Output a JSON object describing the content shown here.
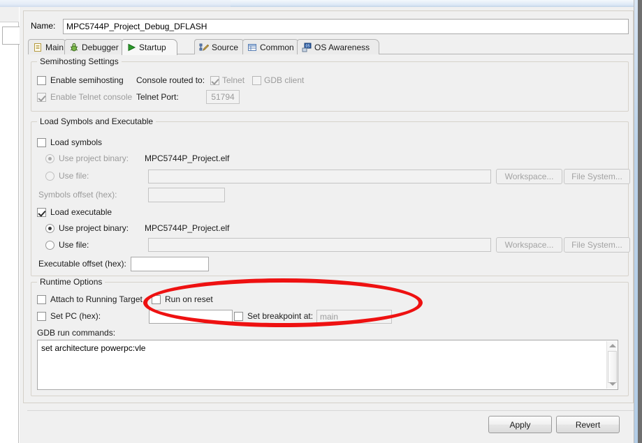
{
  "window": {
    "accent_blue": "#bcd3ea",
    "border_grey": "#6f6f6f",
    "dialog_bg": "#f0f0f0"
  },
  "name_row": {
    "label": "Name:",
    "value": "MPC5744P_Project_Debug_DFLASH"
  },
  "tabs": [
    {
      "label": "Main",
      "icon": "document-icon",
      "active": false
    },
    {
      "label": "Debugger",
      "icon": "bug-icon",
      "active": false
    },
    {
      "label": "Startup",
      "icon": "play-arrow-icon",
      "active": true
    },
    {
      "label": "Source",
      "icon": "source-pencil-icon",
      "active": false
    },
    {
      "label": "Common",
      "icon": "table-icon",
      "active": false
    },
    {
      "label": "OS Awareness",
      "icon": "os-monitor-icon",
      "active": false
    }
  ],
  "semihosting": {
    "group_title": "Semihosting Settings",
    "enable_semihosting": {
      "label": "Enable semihosting",
      "checked": false,
      "disabled": false
    },
    "enable_telnet_console": {
      "label": "Enable Telnet console",
      "checked": true,
      "disabled": true
    },
    "console_routed_to_label": "Console routed to:",
    "telnet": {
      "label": "Telnet",
      "checked": true,
      "disabled": true
    },
    "gdb_client": {
      "label": "GDB client",
      "checked": false,
      "disabled": true
    },
    "telnet_port_label": "Telnet Port:",
    "telnet_port_value": "51794"
  },
  "load_symbols": {
    "group_title": "Load Symbols and Executable",
    "load_symbols": {
      "label": "Load symbols",
      "checked": false,
      "disabled": false
    },
    "sym_use_project_binary": {
      "label": "Use project binary:",
      "selected": true,
      "disabled": true
    },
    "sym_project_binary_value": "MPC5744P_Project.elf",
    "sym_use_file": {
      "label": "Use file:",
      "selected": false,
      "disabled": true
    },
    "sym_use_file_value": "",
    "sym_workspace_button": "Workspace...",
    "sym_filesystem_button": "File System...",
    "symbols_offset_label": "Symbols offset (hex):",
    "symbols_offset_value": "",
    "load_executable": {
      "label": "Load executable",
      "checked": true,
      "disabled": false
    },
    "exe_use_project_binary": {
      "label": "Use project binary:",
      "selected": true,
      "disabled": false
    },
    "exe_project_binary_value": "MPC5744P_Project.elf",
    "exe_use_file": {
      "label": "Use file:",
      "selected": false,
      "disabled": false
    },
    "exe_use_file_value": "",
    "exe_workspace_button": "Workspace...",
    "exe_filesystem_button": "File System...",
    "executable_offset_label": "Executable offset (hex):",
    "executable_offset_value": ""
  },
  "runtime": {
    "group_title": "Runtime Options",
    "attach_to_running_target": {
      "label": "Attach to Running Target",
      "checked": false,
      "disabled": false
    },
    "run_on_reset": {
      "label": "Run on reset",
      "checked": false,
      "disabled": false
    },
    "set_pc": {
      "label": "Set PC (hex):",
      "checked": false,
      "disabled": false
    },
    "set_pc_value": "",
    "set_breakpoint_at": {
      "label": "Set breakpoint at:",
      "checked": false,
      "disabled": false
    },
    "breakpoint_placeholder": "main",
    "breakpoint_value": "",
    "gdb_run_commands_label": "GDB run commands:",
    "gdb_run_commands_value": "set architecture powerpc:vle"
  },
  "footer": {
    "apply_label": "Apply",
    "revert_label": "Revert"
  },
  "annotation": {
    "shape": "ellipse",
    "color": "#ee1111",
    "target": "run-on-reset-and-breakpoint-controls"
  }
}
